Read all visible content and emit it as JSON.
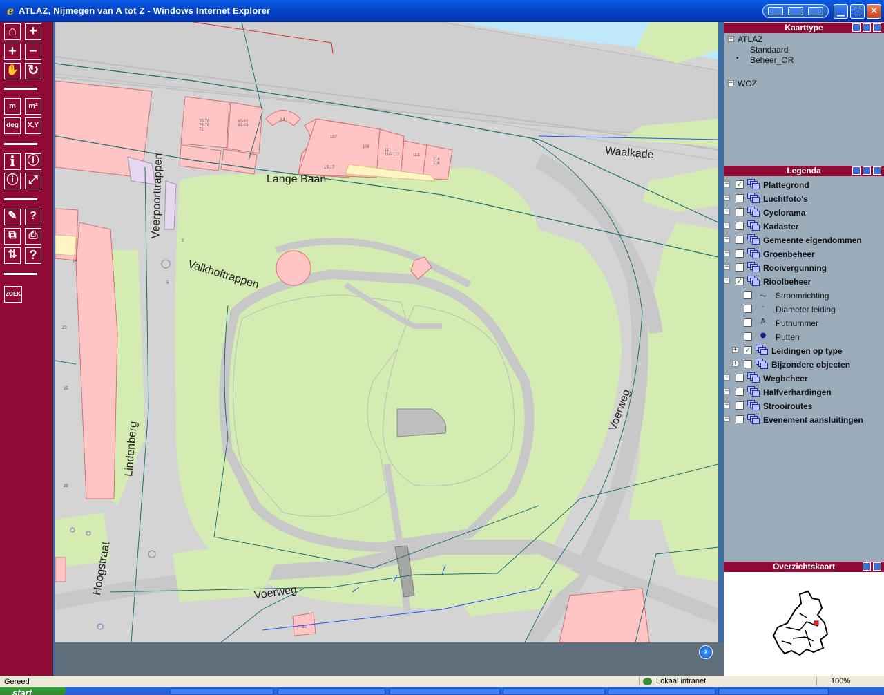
{
  "window": {
    "title": "ATLAZ, Nijmegen van A tot Z - Windows Internet Explorer",
    "minimize_glyph": "▁",
    "maximize_glyph": "□",
    "close_glyph": "✕"
  },
  "toolbar": {
    "buttons": [
      {
        "name": "home-icon",
        "glyph": "⌂"
      },
      {
        "name": "zoom-in-icon",
        "glyph": "+"
      },
      {
        "name": "plus-icon",
        "glyph": "+"
      },
      {
        "name": "minus-icon",
        "glyph": "−"
      },
      {
        "name": "pan-hand-icon",
        "glyph": "✋"
      },
      {
        "name": "refresh-icon",
        "glyph": "↻"
      },
      {
        "name": "measure-length-button",
        "glyph": "m"
      },
      {
        "name": "measure-area-button",
        "glyph": "m²"
      },
      {
        "name": "degrees-button",
        "glyph": "deg"
      },
      {
        "name": "coordinates-button",
        "glyph": "X,Y"
      },
      {
        "name": "info-icon",
        "glyph": "i"
      },
      {
        "name": "info-circle-icon",
        "glyph": "ⓘ"
      },
      {
        "name": "info-query-icon",
        "glyph": "ⓘ"
      },
      {
        "name": "fullscreen-icon",
        "glyph": "⤢"
      },
      {
        "name": "edit-icon",
        "glyph": "✎"
      },
      {
        "name": "help-doc-icon",
        "glyph": "?"
      },
      {
        "name": "layers-icon",
        "glyph": "⧉"
      },
      {
        "name": "print-icon",
        "glyph": "⎙"
      },
      {
        "name": "sort-icon",
        "glyph": "⇅"
      },
      {
        "name": "help-icon",
        "glyph": "?"
      },
      {
        "name": "zoek-button",
        "glyph": "ZOEK"
      }
    ]
  },
  "map": {
    "street_labels": {
      "lange_baan": "Lange Baan",
      "waalkade": "Waalkade",
      "veerpoorttrappen": "Veerpoorttrappen",
      "valkhoftrappen": "Valkhoftrappen",
      "lindenberg": "Lindenberg",
      "hoogstraat": "Hoogstraat",
      "voerweg_east": "Voerweg",
      "voerweg_south": "Voerweg"
    },
    "house_numbers": {
      "h1": "70-78\n75-79\n71",
      "h2": "80-82\n81-83",
      "h3": "84",
      "h4": "107",
      "h5": "108",
      "h6": "111\n110-112",
      "h7": "113",
      "h8": "114\n116",
      "h9": "15-17",
      "h10": "2",
      "h11": "5",
      "h12": "14",
      "h13": "23",
      "h14": "25",
      "h15": "29",
      "h16": "80"
    },
    "pan_arrow_glyph": "›"
  },
  "kaarttype": {
    "title": "Kaarttype",
    "root_label": "ATLAZ",
    "root_expander": "−",
    "options": [
      {
        "label": "Standaard",
        "selected": false
      },
      {
        "label": "Beheer_OR",
        "selected": true
      }
    ],
    "selected_marker": "•",
    "woz_label": "WOZ",
    "woz_expander": "+"
  },
  "legenda": {
    "title": "Legenda",
    "check_glyph": "✓",
    "layers": [
      {
        "label": "Plattegrond",
        "checked": true,
        "expander": "+"
      },
      {
        "label": "Luchtfoto's",
        "checked": false,
        "expander": "+"
      },
      {
        "label": "Cyclorama",
        "checked": false,
        "expander": "+"
      },
      {
        "label": "Kadaster",
        "checked": false,
        "expander": "+"
      },
      {
        "label": "Gemeente eigendommen",
        "checked": false,
        "expander": "+"
      },
      {
        "label": "Groenbeheer",
        "checked": false,
        "expander": "+"
      },
      {
        "label": "Rooivergunning",
        "checked": false,
        "expander": "+"
      },
      {
        "label": "Rioolbeheer",
        "checked": true,
        "expander": "−"
      }
    ],
    "rioolbeheer_items": [
      {
        "label": "Stroomrichting",
        "checked": false,
        "symbol": "〜"
      },
      {
        "label": "Diameter leiding",
        "checked": false,
        "symbol": "·"
      },
      {
        "label": "Putnummer",
        "checked": false,
        "symbol": "A"
      },
      {
        "label": "Putten",
        "checked": false,
        "symbol": "●"
      }
    ],
    "rioolbeheer_groups": [
      {
        "label": "Leidingen op type",
        "checked": true,
        "expander": "+"
      },
      {
        "label": "Bijzondere objecten",
        "checked": false,
        "expander": "+"
      }
    ],
    "layers_after": [
      {
        "label": "Wegbeheer",
        "checked": false,
        "expander": "+"
      },
      {
        "label": "Halfverhardingen",
        "checked": false,
        "expander": "+"
      },
      {
        "label": "Strooiroutes",
        "checked": false,
        "expander": "+"
      },
      {
        "label": "Evenement aansluitingen",
        "checked": false,
        "expander": "+"
      }
    ]
  },
  "overzicht": {
    "title": "Overzichtskaart"
  },
  "statusbar": {
    "text": "Gereed",
    "zone": "Lokaal intranet",
    "zoom": "100%"
  },
  "taskbar": {
    "start_label": "start"
  },
  "colors": {
    "toolbar": "#8f0b36",
    "map_road": "#d4d4d4",
    "map_green": "#d4ecb2",
    "map_building": "#ffc5c5",
    "map_water": "#bfe8f8",
    "panel_body": "#9aabb9"
  }
}
